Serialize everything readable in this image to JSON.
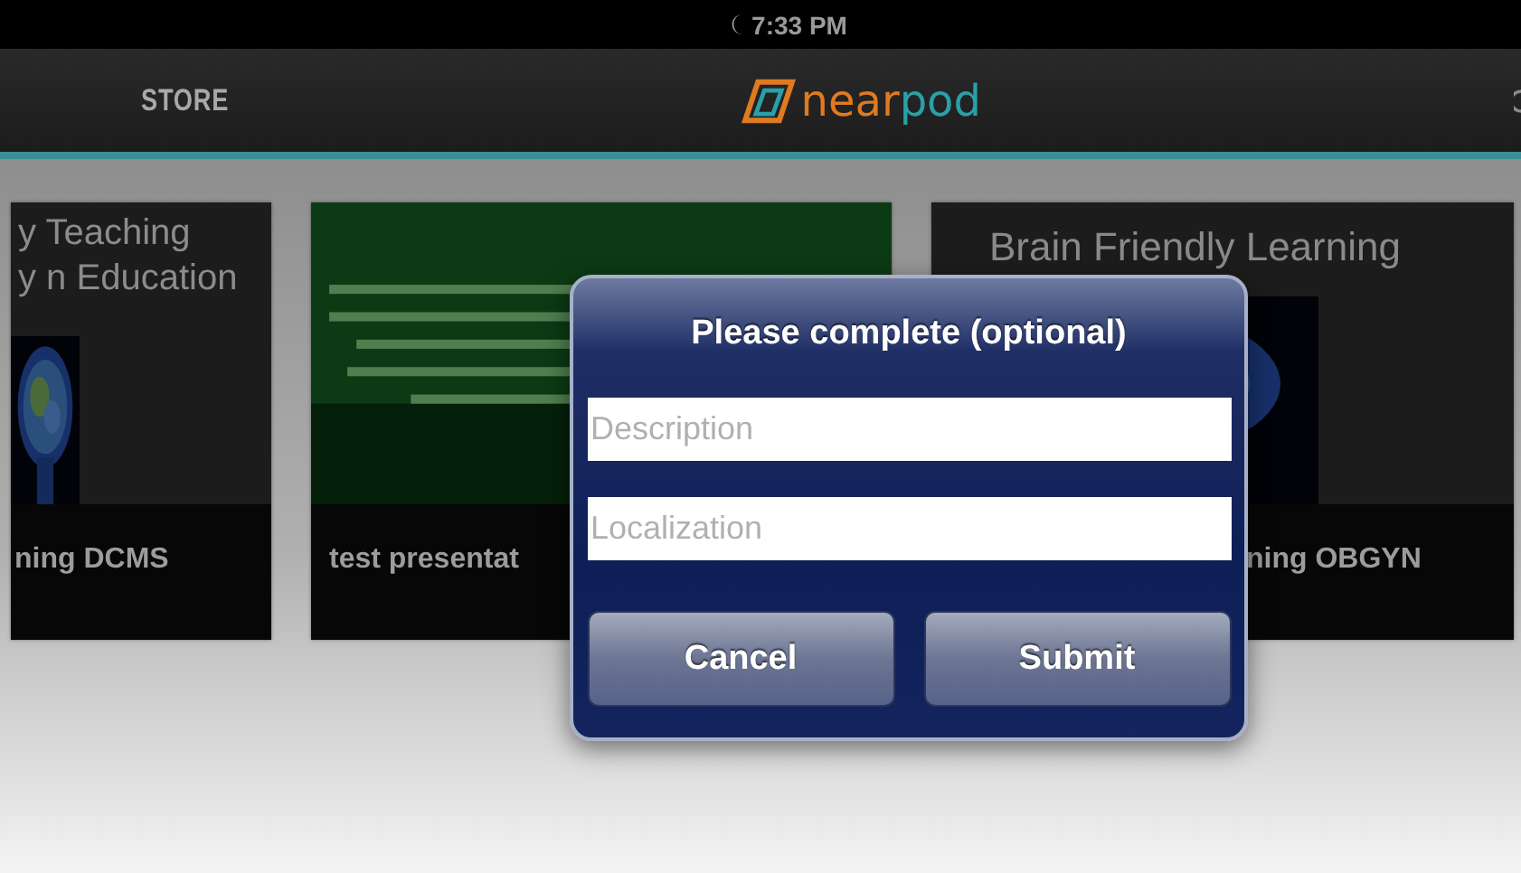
{
  "status_bar": {
    "time": "7:33 PM"
  },
  "nav": {
    "store": "STORE",
    "logo": "nearpod"
  },
  "cards": [
    {
      "kind": "title-slide",
      "title_lines": [
        "y Teaching",
        "y n Education"
      ],
      "label": "ning DCMS"
    },
    {
      "kind": "picture",
      "label": "test presentat"
    },
    {
      "kind": "title-slide",
      "title_lines": [
        "Brain Friendly Learning"
      ],
      "label": "ning OBGYN"
    }
  ],
  "dialog": {
    "title": "Please complete (optional)",
    "fields": [
      {
        "placeholder": "Description"
      },
      {
        "placeholder": "Localization"
      }
    ],
    "buttons": [
      "Cancel",
      "Submit"
    ]
  }
}
